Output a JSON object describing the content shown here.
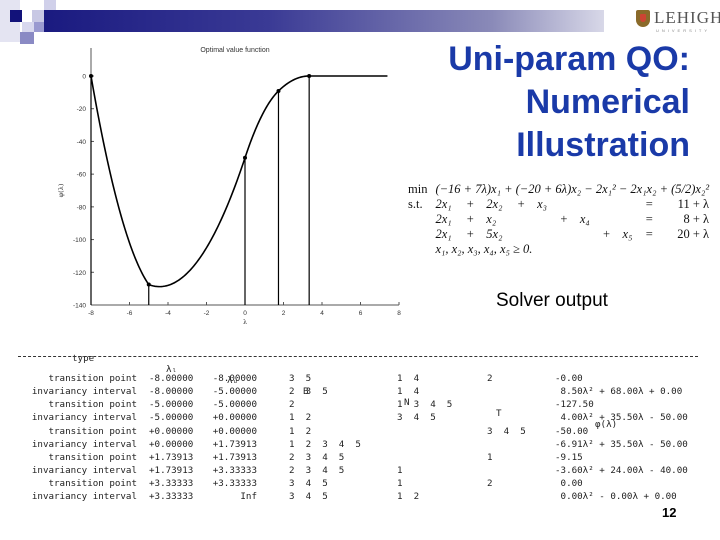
{
  "slide": {
    "title_lines": [
      "Uni-param QO:",
      "Numerical",
      "Illustration"
    ],
    "logo_text": "LEHIGH",
    "logo_subtext": "UNIVERSITY",
    "solver_label": "Solver output",
    "page_number": "12",
    "accent_color": "#1a3aa8",
    "bar_color": "#1a1a80"
  },
  "problem": {
    "objective_label": "min",
    "objective": "(−16 + 7λ)x₁ + (−20 + 6λ)x₂ − 2x₁² − 2x₁x₂ + (5/2)x₂²",
    "st_label": "s.t.",
    "constraints": [
      {
        "lhs": [
          "2x₁",
          "+",
          "2x₂",
          "+",
          "x₃",
          "",
          "",
          "",
          ""
        ],
        "eq": "=",
        "rhs": "11 + λ"
      },
      {
        "lhs": [
          "2x₁",
          "+",
          "x₂",
          "",
          "",
          "+",
          "x₄",
          "",
          ""
        ],
        "eq": "=",
        "rhs": "8 + λ"
      },
      {
        "lhs": [
          "2x₁",
          "+",
          "5x₂",
          "",
          "",
          "",
          "",
          "+",
          "x₅"
        ],
        "eq": "=",
        "rhs": "20 + λ"
      }
    ],
    "nonneg": "x₁, x₂, x₃, x₄, x₅ ≥ 0."
  },
  "chart_data": {
    "type": "line",
    "title": "Optimal value function",
    "xlabel": "λ",
    "ylabel": "φ(λ)",
    "xlim": [
      -8,
      8
    ],
    "ylim": [
      -140,
      0
    ],
    "xticks": [
      -8,
      -6,
      -4,
      -2,
      0,
      2,
      4,
      6,
      8
    ],
    "yticks": [
      0,
      -20,
      -40,
      -60,
      -80,
      -100,
      -120,
      -140
    ],
    "grid": false,
    "transition_points": [
      {
        "lambda": -8.0,
        "phi": 0.0
      },
      {
        "lambda": -5.0,
        "phi": -127.5
      },
      {
        "lambda": 0.0,
        "phi": -50.0
      },
      {
        "lambda": 1.73913,
        "phi": -9.15
      },
      {
        "lambda": 3.33333,
        "phi": 0.0
      }
    ],
    "pieces": [
      {
        "from": -8.0,
        "to": -5.0,
        "a": 8.5,
        "b": 68.0,
        "c": 0.0
      },
      {
        "from": -5.0,
        "to": 0.0,
        "a": 4.0,
        "b": 35.5,
        "c": -50.0
      },
      {
        "from": 0.0,
        "to": 1.73913,
        "a": -6.91,
        "b": 35.5,
        "c": -50.0
      },
      {
        "from": 1.73913,
        "to": 3.33333,
        "a": -3.6,
        "b": 24.0,
        "c": -40.0
      },
      {
        "from": 3.33333,
        "to": 7.4,
        "a": 0.0,
        "b": 0.0,
        "c": 0.0
      }
    ]
  },
  "solver_output": {
    "headers": {
      "type": "type",
      "lambda_l": "λₗ",
      "lambda_u": "λᵤ",
      "B": "B",
      "N": "N",
      "T": "T",
      "phi": "φ(λ)"
    },
    "rows": [
      {
        "type": "transition point",
        "lambda_l": "-8.00000",
        "lambda_u": "-8.00000",
        "B": "3  5",
        "N": "1  4",
        "T": "2",
        "phi": "-0.00"
      },
      {
        "type": "invariancy interval",
        "lambda_l": "-8.00000",
        "lambda_u": "-5.00000",
        "B": "2  3  5",
        "N": "1  4",
        "T": "",
        "phi": " 8.50λ² + 68.00λ + 0.00"
      },
      {
        "type": "transition point",
        "lambda_l": "-5.00000",
        "lambda_u": "-5.00000",
        "B": "2",
        "N": "1  3  4  5",
        "T": "",
        "phi": "-127.50"
      },
      {
        "type": "invariancy interval",
        "lambda_l": "-5.00000",
        "lambda_u": "+0.00000",
        "B": "1  2",
        "N": "3  4  5",
        "T": "",
        "phi": " 4.00λ² + 35.50λ - 50.00"
      },
      {
        "type": "transition point",
        "lambda_l": "+0.00000",
        "lambda_u": "+0.00000",
        "B": "1  2",
        "N": "",
        "T": "3  4  5",
        "phi": "-50.00"
      },
      {
        "type": "invariancy interval",
        "lambda_l": "+0.00000",
        "lambda_u": "+1.73913",
        "B": "1  2  3  4  5",
        "N": "",
        "T": "",
        "phi": "-6.91λ² + 35.50λ - 50.00"
      },
      {
        "type": "transition point",
        "lambda_l": "+1.73913",
        "lambda_u": "+1.73913",
        "B": "2  3  4  5",
        "N": "",
        "T": "1",
        "phi": "-9.15"
      },
      {
        "type": "invariancy interval",
        "lambda_l": "+1.73913",
        "lambda_u": "+3.33333",
        "B": "2  3  4  5",
        "N": "1",
        "T": "",
        "phi": "-3.60λ² + 24.00λ - 40.00"
      },
      {
        "type": "transition point",
        "lambda_l": "+3.33333",
        "lambda_u": "+3.33333",
        "B": "3  4  5",
        "N": "1",
        "T": "2",
        "phi": " 0.00"
      },
      {
        "type": "invariancy interval",
        "lambda_l": "+3.33333",
        "lambda_u": "Inf",
        "B": "3  4  5",
        "N": "1  2",
        "T": "",
        "phi": " 0.00λ² - 0.00λ + 0.00"
      }
    ]
  }
}
